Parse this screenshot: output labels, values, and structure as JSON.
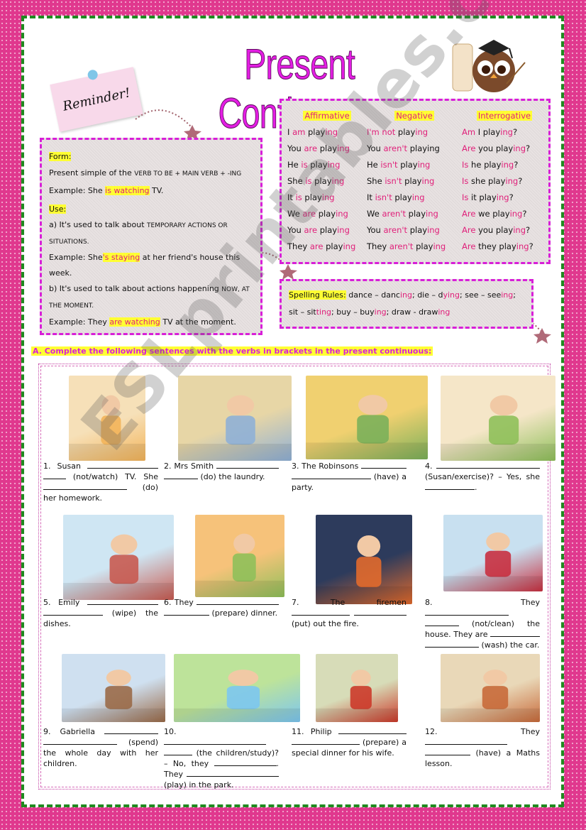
{
  "title": "Present Continuous",
  "reminder_note": "Reminder!",
  "form_box": {
    "form_label": "Form:",
    "form_text_a": "Present simple of the ",
    "form_text_sc": "VERB TO BE + MAIN VERB + -ING",
    "form_example_prefix": "Example: She ",
    "form_example_hl": "is watching",
    "form_example_suffix": " TV.",
    "use_label": "Use:",
    "use_a_prefix": "a) It's used to talk about ",
    "use_a_sc": "TEMPORARY ACTIONS OR SITUATIONS.",
    "use_a_example_prefix": "Example: She",
    "use_a_example_hl": "'s staying",
    "use_a_example_suffix": " at her friend's house this week.",
    "use_b_prefix": "b) It's used to talk about actions happening ",
    "use_b_sc": "NOW, AT THE MOMENT.",
    "use_b_example_prefix": "Example: They ",
    "use_b_example_hl": "are watching",
    "use_b_example_suffix": " TV at the moment."
  },
  "conjugation": {
    "headers": [
      "Affirmative",
      "Negative",
      "Interrogative"
    ],
    "rows": [
      [
        [
          "I ",
          "am",
          " play",
          "ing",
          ""
        ],
        [
          "",
          "I'm not",
          " play",
          "ing",
          ""
        ],
        [
          "",
          "Am",
          " I play",
          "ing",
          "?"
        ]
      ],
      [
        [
          "You ",
          "are",
          " play",
          "ing",
          ""
        ],
        [
          "You ",
          "aren't",
          " playing",
          "",
          ""
        ],
        [
          "",
          "Are",
          " you play",
          "ing",
          "?"
        ]
      ],
      [
        [
          "He ",
          "is",
          " play",
          "ing",
          ""
        ],
        [
          "He ",
          "isn't",
          " play",
          "ing",
          ""
        ],
        [
          "",
          "Is",
          " he play",
          "ing",
          "?"
        ]
      ],
      [
        [
          "She ",
          "is",
          " play",
          "ing",
          ""
        ],
        [
          "She ",
          "isn't",
          " play",
          "ing",
          ""
        ],
        [
          "",
          "Is",
          " she play",
          "ing",
          "?"
        ]
      ],
      [
        [
          "It ",
          "is",
          " play",
          "ing",
          ""
        ],
        [
          "It ",
          "isn't",
          " play",
          "ing",
          ""
        ],
        [
          "",
          "Is",
          " it play",
          "ing",
          "?"
        ]
      ],
      [
        [
          "We ",
          "are",
          " play",
          "ing",
          ""
        ],
        [
          "We ",
          "aren't",
          " play",
          "ing",
          ""
        ],
        [
          "",
          "Are",
          " we play",
          "ing",
          "?"
        ]
      ],
      [
        [
          "You ",
          "are",
          " play",
          "ing",
          ""
        ],
        [
          "You ",
          "aren't",
          " play",
          "ing",
          ""
        ],
        [
          "",
          "Are",
          " you play",
          "ing",
          "?"
        ]
      ],
      [
        [
          "They ",
          "are",
          " play",
          "ing",
          ""
        ],
        [
          "They ",
          "aren't",
          " play",
          "ing",
          ""
        ],
        [
          "",
          "Are",
          " they play",
          "ing",
          "?"
        ]
      ]
    ]
  },
  "spelling": {
    "label": "Spelling Rules:",
    "line1": [
      " dance – danc",
      "ing",
      "; die – d",
      "ying",
      "; see – see",
      "ing",
      ";"
    ],
    "line2": [
      "sit – sit",
      "ting",
      "; buy – buy",
      "ing",
      "; draw - draw",
      "ing",
      ""
    ]
  },
  "instruction": "A. Complete the following sentences with the verbs in brackets in the present continuous:",
  "exercises": [
    {
      "num": "1.",
      "parts": [
        "Susan",
        "(not/watch) TV. She",
        "(do)",
        "her homework."
      ],
      "picture": "girl-doing-homework"
    },
    {
      "num": "2.",
      "parts": [
        "Mrs Smith",
        "(do) the laundry."
      ],
      "picture": "woman-doing-laundry"
    },
    {
      "num": "3.",
      "parts": [
        "The Robinsons",
        "(have) a",
        "party."
      ],
      "picture": "family-party"
    },
    {
      "num": "4.",
      "parts": [
        "(Susan/exercise)? – Yes, she",
        "."
      ],
      "picture": "girl-exercising"
    },
    {
      "num": "5.",
      "parts": [
        "Emily",
        "(wipe) the",
        "dishes."
      ],
      "picture": "girl-wiping-dishes"
    },
    {
      "num": "6.",
      "parts": [
        "They",
        "(prepare) dinner."
      ],
      "picture": "kids-cooking"
    },
    {
      "num": "7.",
      "parts": [
        "The firemen",
        "(put) out the",
        "fire."
      ],
      "picture": "firemen-fire"
    },
    {
      "num": "8.",
      "parts": [
        "They",
        "(not/clean) the",
        "house. They are",
        "(wash) the car."
      ],
      "picture": "kids-washing-car"
    },
    {
      "num": "9.",
      "parts": [
        "Gabriella",
        "(spend)",
        "the whole day with her",
        "children."
      ],
      "picture": "mother-children"
    },
    {
      "num": "10.",
      "parts": [
        "(the children/study)?",
        "– No, they",
        ".",
        "They",
        "(play) in the park."
      ],
      "picture": "children-park"
    },
    {
      "num": "11.",
      "parts": [
        "Philip",
        "(prepare)",
        "a special dinner for his wife."
      ],
      "picture": "man-cooking"
    },
    {
      "num": "12.",
      "parts": [
        "They",
        "(have) a Maths",
        "lesson."
      ],
      "picture": "classroom"
    }
  ],
  "watermark": "ESLprintables.com",
  "colors": {
    "border_pink": "#e0388e",
    "frame_green": "#1f8a1f",
    "title_magenta": "#e31ee3",
    "box_dash": "#d81fd8",
    "highlight": "#ffff33",
    "accent_red": "#e0207a"
  }
}
